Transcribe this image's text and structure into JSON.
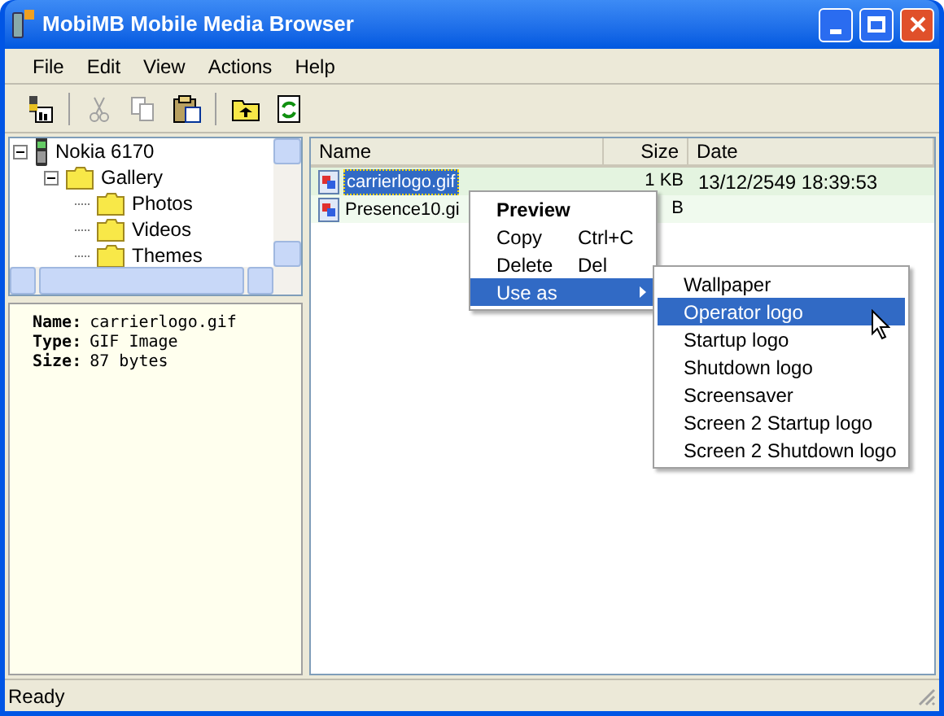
{
  "window": {
    "title": "MobiMB Mobile Media Browser"
  },
  "menu_bar": [
    "File",
    "Edit",
    "View",
    "Actions",
    "Help"
  ],
  "toolbar": [
    {
      "kind": "device",
      "disabled": false
    },
    {
      "kind": "cut",
      "disabled": true
    },
    {
      "kind": "copy",
      "disabled": true
    },
    {
      "kind": "paste",
      "disabled": false
    },
    {
      "kind": "up",
      "disabled": false
    },
    {
      "kind": "refresh",
      "disabled": false
    }
  ],
  "tree": [
    {
      "label": "Nokia 6170",
      "kind": "phone",
      "expanded": true,
      "children": [
        {
          "label": "Gallery",
          "kind": "folder",
          "expanded": true,
          "children": [
            {
              "label": "Photos",
              "kind": "folder"
            },
            {
              "label": "Videos",
              "kind": "folder"
            },
            {
              "label": "Themes",
              "kind": "folder"
            }
          ]
        }
      ]
    }
  ],
  "info": [
    {
      "label": "Name:",
      "value": "carrierlogo.gif"
    },
    {
      "label": "Type:",
      "value": "GIF Image"
    },
    {
      "label": "Size:",
      "value": "87 bytes"
    }
  ],
  "table": {
    "columns": [
      "Name",
      "Size",
      "Date"
    ],
    "rows": [
      {
        "name": "carrierlogo.gif",
        "size": "1 KB",
        "date": "13/12/2549 18:39:53",
        "selected": true
      },
      {
        "name": "Presence10.gi",
        "size": "B",
        "date": "",
        "selected": false
      }
    ]
  },
  "context_menu": [
    {
      "label": "Preview",
      "kind": "default",
      "selected": false
    },
    {
      "label": "Copy",
      "shortcut": "Ctrl+C",
      "kind": "item",
      "selected": false
    },
    {
      "label": "Delete",
      "shortcut": "Del",
      "kind": "item",
      "selected": false
    },
    {
      "label": "Use as",
      "kind": "submenu",
      "selected": true
    }
  ],
  "submenu": [
    {
      "label": "Wallpaper",
      "selected": false
    },
    {
      "label": "Operator logo",
      "selected": true
    },
    {
      "label": "Startup logo",
      "selected": false
    },
    {
      "label": "Shutdown logo",
      "selected": false
    },
    {
      "label": "Screensaver",
      "selected": false
    },
    {
      "label": "Screen 2 Startup logo",
      "selected": false
    },
    {
      "label": "Screen 2 Shutdown logo",
      "selected": false
    }
  ],
  "status_bar": "Ready"
}
